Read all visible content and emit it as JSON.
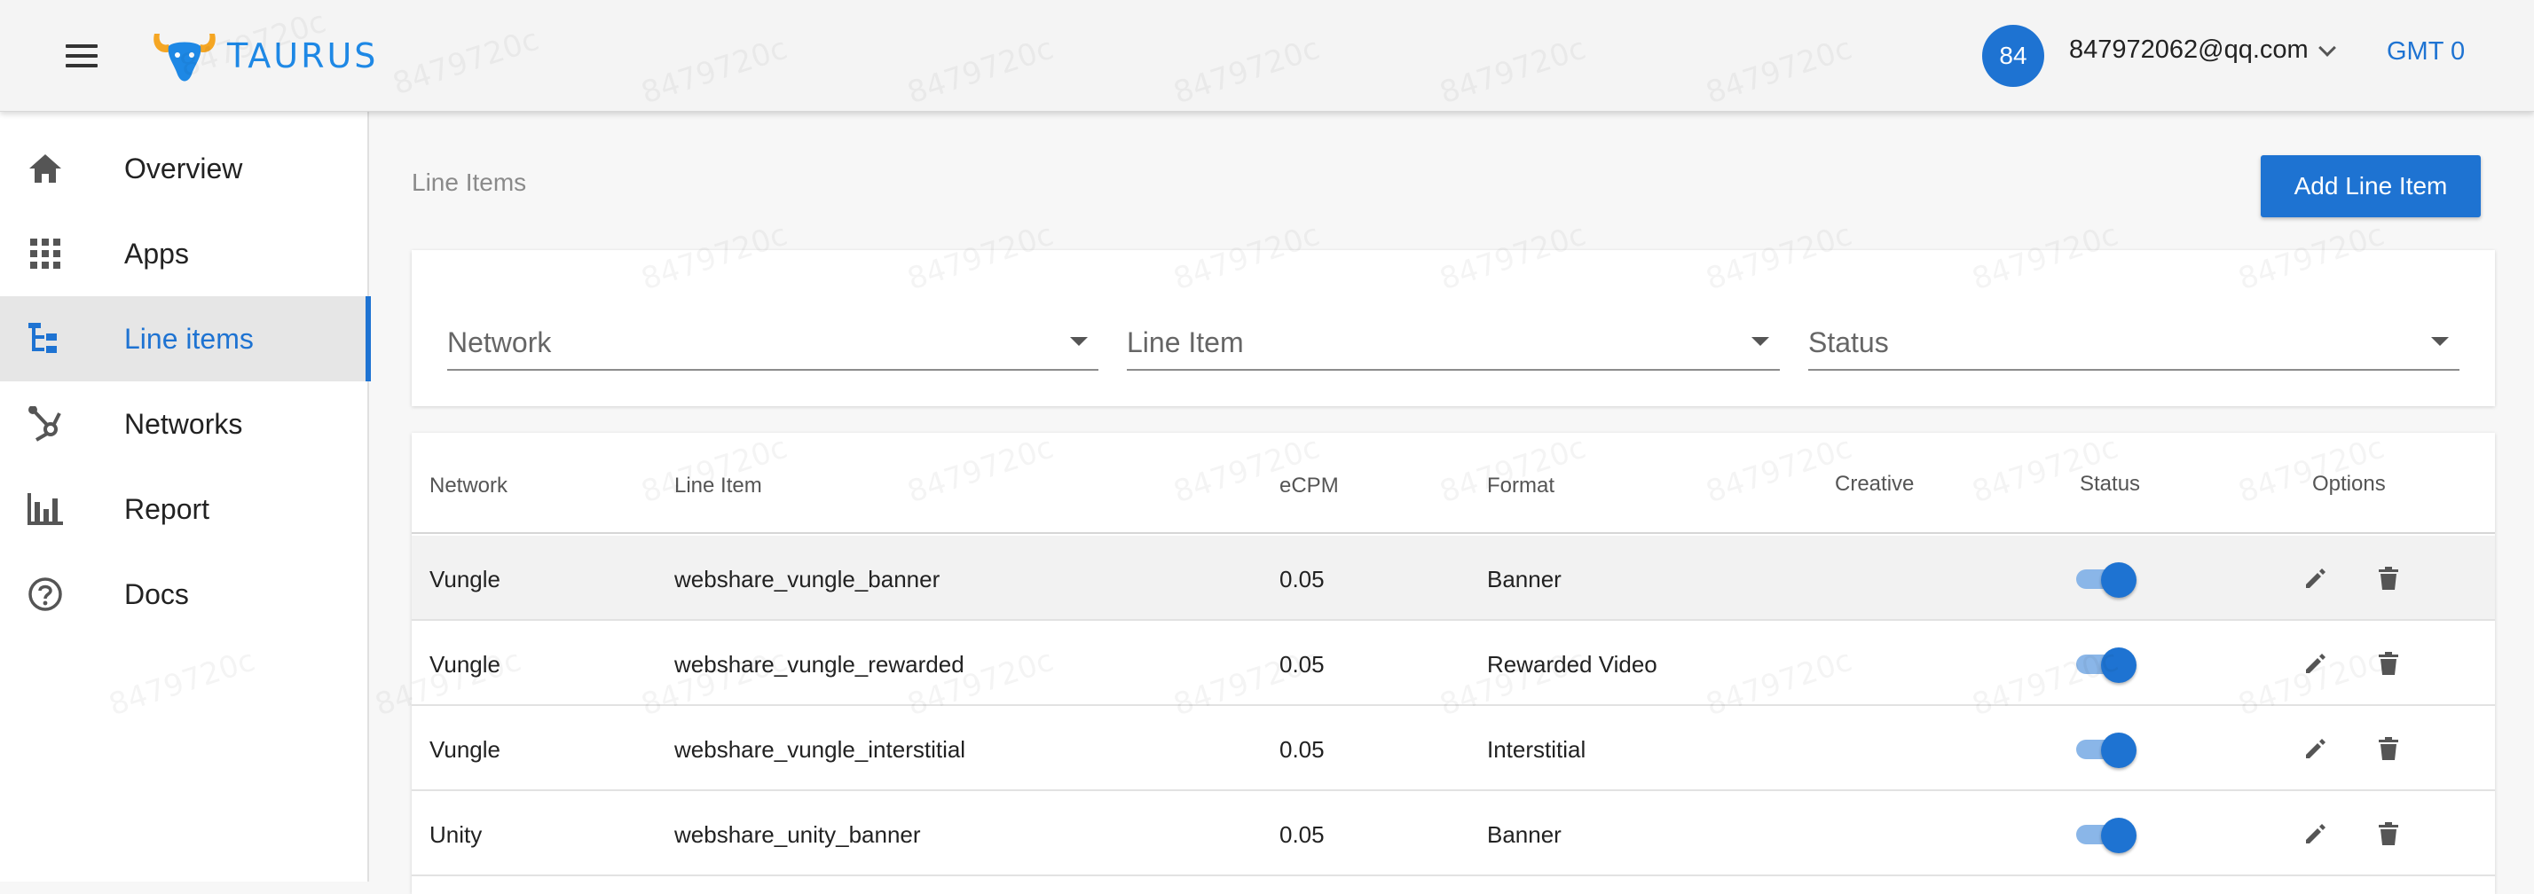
{
  "header": {
    "logo_text": "TAURUS",
    "avatar": "84",
    "user_email": "847972062@qq.com",
    "timezone": "GMT 0"
  },
  "sidebar": {
    "items": [
      {
        "label": "Overview",
        "icon": "home-icon"
      },
      {
        "label": "Apps",
        "icon": "apps-grid-icon"
      },
      {
        "label": "Line items",
        "icon": "line-items-icon",
        "active": true
      },
      {
        "label": "Networks",
        "icon": "networks-icon"
      },
      {
        "label": "Report",
        "icon": "report-icon"
      },
      {
        "label": "Docs",
        "icon": "help-icon"
      }
    ]
  },
  "main": {
    "breadcrumb": "Line Items",
    "add_button": "Add Line Item",
    "filters": [
      {
        "label": "Network"
      },
      {
        "label": "Line Item"
      },
      {
        "label": "Status"
      }
    ],
    "table": {
      "columns": [
        "Network",
        "Line Item",
        "eCPM",
        "Format",
        "Creative",
        "Status",
        "Options"
      ],
      "rows": [
        {
          "network": "Vungle",
          "line_item": "webshare_vungle_banner",
          "ecpm": "0.05",
          "format": "Banner",
          "creative": "",
          "status": true
        },
        {
          "network": "Vungle",
          "line_item": "webshare_vungle_rewarded",
          "ecpm": "0.05",
          "format": "Rewarded Video",
          "creative": "",
          "status": true
        },
        {
          "network": "Vungle",
          "line_item": "webshare_vungle_interstitial",
          "ecpm": "0.05",
          "format": "Interstitial",
          "creative": "",
          "status": true
        },
        {
          "network": "Unity",
          "line_item": "webshare_unity_banner",
          "ecpm": "0.05",
          "format": "Banner",
          "creative": "",
          "status": true
        }
      ]
    }
  },
  "watermark": "8479720c",
  "colors": {
    "accent": "#1e73d2",
    "logo_orange": "#f5a623",
    "toggle_track": "#8ab6e8"
  }
}
